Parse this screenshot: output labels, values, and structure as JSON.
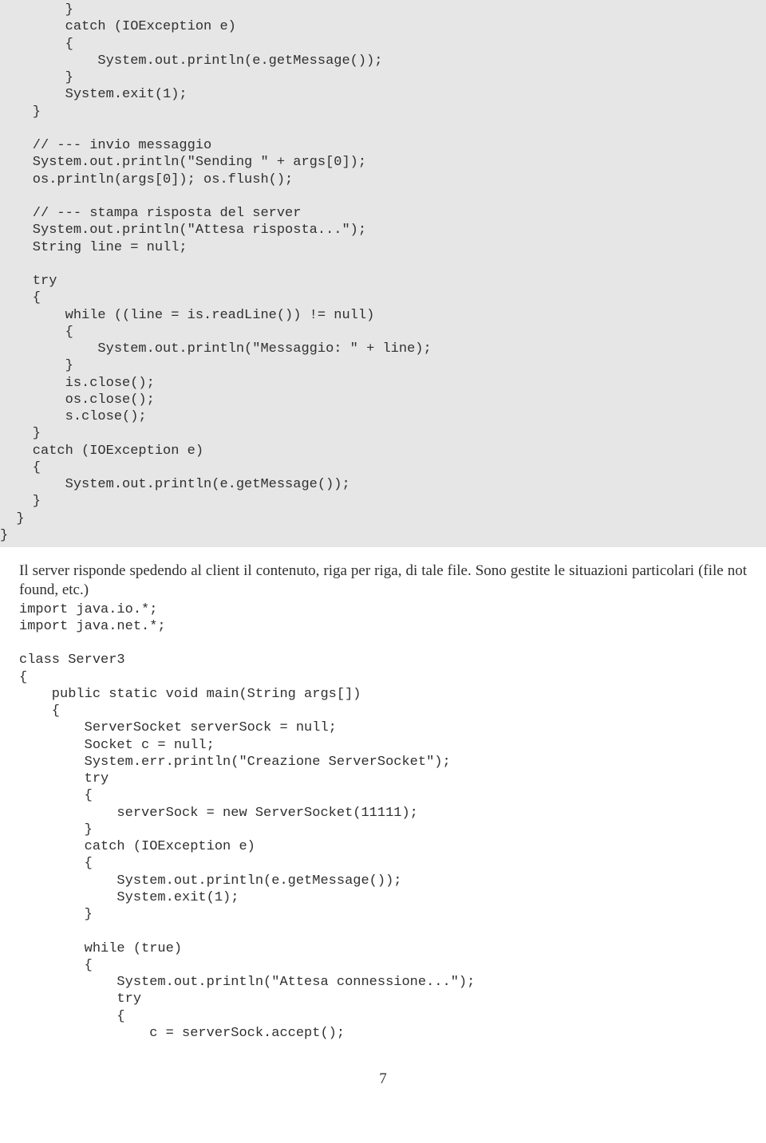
{
  "code1": "        }\n        catch (IOException e)\n        {\n            System.out.println(e.getMessage());\n        }\n        System.exit(1);\n    }\n\n    // --- invio messaggio\n    System.out.println(\"Sending \" + args[0]);\n    os.println(args[0]); os.flush();\n\n    // --- stampa risposta del server\n    System.out.println(\"Attesa risposta...\");\n    String line = null;\n\n    try\n    {\n        while ((line = is.readLine()) != null)\n        {\n            System.out.println(\"Messaggio: \" + line);\n        }\n        is.close();\n        os.close();\n        s.close();\n    }\n    catch (IOException e)\n    {\n        System.out.println(e.getMessage());\n    }\n  }\n}",
  "prose": "Il server risponde spedendo al client il contenuto, riga per riga, di tale file. Sono gestite le situazioni particolari (file not found, etc.)",
  "code2": "import java.io.*;\nimport java.net.*;\n\nclass Server3\n{\n    public static void main(String args[])\n    {\n        ServerSocket serverSock = null;\n        Socket c = null;\n        System.err.println(\"Creazione ServerSocket\");\n        try\n        {\n            serverSock = new ServerSocket(11111);\n        }\n        catch (IOException e)\n        {\n            System.out.println(e.getMessage());\n            System.exit(1);\n        }\n\n        while (true)\n        {\n            System.out.println(\"Attesa connessione...\");\n            try\n            {\n                c = serverSock.accept();",
  "page_no": "7"
}
